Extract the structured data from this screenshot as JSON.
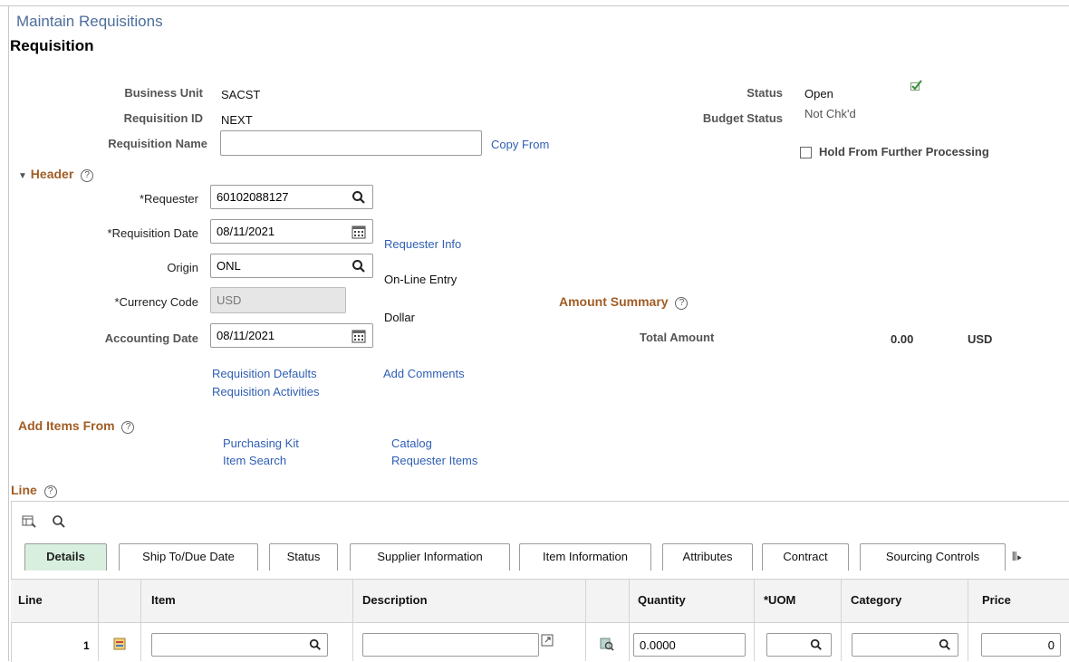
{
  "page": {
    "title": "Maintain Requisitions",
    "subtitle": "Requisition"
  },
  "form": {
    "business_unit_label": "Business Unit",
    "business_unit": "SACST",
    "requisition_id_label": "Requisition ID",
    "requisition_id": "NEXT",
    "requisition_name_label": "Requisition Name",
    "requisition_name": "",
    "copy_from": "Copy From",
    "status_label": "Status",
    "status": "Open",
    "budget_status_label": "Budget Status",
    "budget_status": "Not Chk'd",
    "hold_label": "Hold From Further Processing"
  },
  "header": {
    "section_label": "Header",
    "requester_label": "*Requester",
    "requester": "60102088127",
    "req_date_label": "*Requisition Date",
    "req_date": "08/11/2021",
    "requester_info": "Requester Info",
    "origin_label": "Origin",
    "origin": "ONL",
    "origin_desc": "On-Line Entry",
    "currency_label": "*Currency Code",
    "currency": "USD",
    "currency_desc": "Dollar",
    "acct_date_label": "Accounting Date",
    "acct_date": "08/11/2021",
    "req_defaults": "Requisition Defaults",
    "req_activities": "Requisition Activities",
    "add_comments": "Add Comments"
  },
  "amount_summary": {
    "title": "Amount Summary",
    "total_label": "Total Amount",
    "total": "0.00",
    "currency": "USD"
  },
  "add_items": {
    "title": "Add Items From",
    "purchasing_kit": "Purchasing Kit",
    "item_search": "Item Search",
    "catalog": "Catalog",
    "requester_items": "Requester Items"
  },
  "line": {
    "title": "Line",
    "tabs": [
      "Details",
      "Ship To/Due Date",
      "Status",
      "Supplier Information",
      "Item Information",
      "Attributes",
      "Contract",
      "Sourcing Controls"
    ],
    "columns": [
      "Line",
      "Item",
      "Description",
      "Quantity",
      "*UOM",
      "Category",
      "Price"
    ],
    "row": {
      "line": "1",
      "item": "",
      "description": "",
      "quantity": "0.0000",
      "uom": "",
      "category": "",
      "price": "0"
    }
  },
  "colors": {
    "link": "#2f5fb3",
    "section": "#a15d24",
    "title": "#4d6e9a",
    "active_tab": "#d8efdf"
  },
  "icons": [
    "search-icon",
    "calendar-icon",
    "checkmark-icon",
    "help-icon",
    "grid-personalize-icon",
    "expand-text-icon",
    "item-detail-icon",
    "line-detail-icon",
    "more-tabs-icon"
  ]
}
